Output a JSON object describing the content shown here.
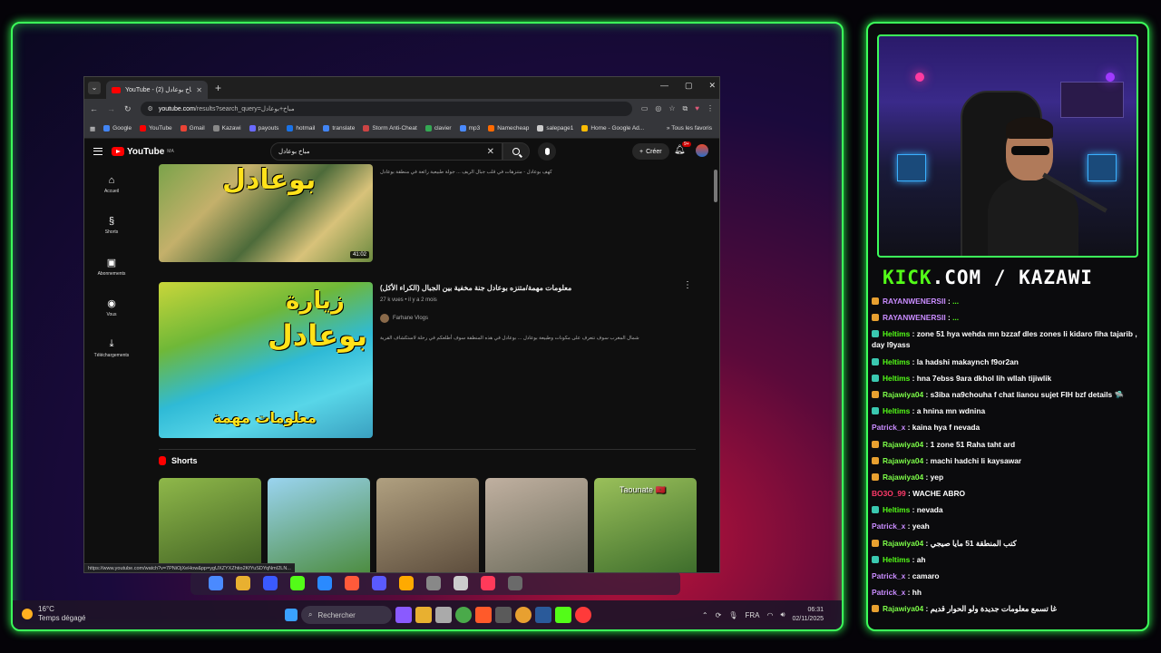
{
  "browser": {
    "tab_title": "YouTube - مباخ بوعادل (2)",
    "url_host": "youtube.com",
    "url_path": "/results?search_query=مباخ+بوعادل",
    "bookmarks": [
      {
        "label": "Google",
        "color": "#4285f4"
      },
      {
        "label": "YouTube",
        "color": "#ff0000"
      },
      {
        "label": "Gmail",
        "color": "#ea4335"
      },
      {
        "label": "Kazawi",
        "color": "#888888"
      },
      {
        "label": "payouts",
        "color": "#6a6aff"
      },
      {
        "label": "hotmail",
        "color": "#1a73e8"
      },
      {
        "label": "translate",
        "color": "#4285f4"
      },
      {
        "label": "Storm Anti-Cheat",
        "color": "#cc4444"
      },
      {
        "label": "clavier",
        "color": "#34a853"
      },
      {
        "label": "mp3",
        "color": "#4a8aff"
      },
      {
        "label": "Namecheap",
        "color": "#ff6a00"
      },
      {
        "label": "salepage1",
        "color": "#cccccc"
      },
      {
        "label": "Home - Google Ad...",
        "color": "#fbbc04"
      }
    ],
    "all_bookmarks": "Tous les favoris",
    "status_url": "https://www.youtube.com/watch?v=7PNiOjXeHow&pp=ygUXZYXZhtio2KfYuSDYqNmI2LN..."
  },
  "youtube": {
    "logo": "YouTube",
    "logo_region": "MA",
    "search_value": "مباخ بوعادل",
    "create_label": "Créer",
    "notif_count": "9+",
    "sidebar": [
      {
        "icon": "home-icon",
        "glyph": "⌂",
        "label": "Accueil"
      },
      {
        "icon": "shorts-icon",
        "glyph": "§",
        "label": "Shorts"
      },
      {
        "icon": "subscriptions-icon",
        "glyph": "▣",
        "label": "Abonnements"
      },
      {
        "icon": "you-icon",
        "glyph": "◉",
        "label": "Vous"
      },
      {
        "icon": "download-icon",
        "glyph": "⤓",
        "label": "Téléchargements"
      }
    ],
    "video1": {
      "thumb_text": "بوعادل",
      "duration": "41:02",
      "desc": "كهف بوعادل - متنزهات في قلب جبال الريف ... جولة طبيعية رائعة في منطقة بوعادل"
    },
    "video2": {
      "title": "معلومات مهمة/متنزه بوعادل جنة مخفية بين الجبال (الكراء الأكل)",
      "thumb_top": "زيارة",
      "thumb_mid": "بوعادل",
      "thumb_bottom": "معلومات مهمة",
      "views": "27 k vues",
      "age": "il y a 2 mois",
      "channel": "Farhane Vlogs",
      "desc": "شمال المغرب سوف نتعرف على مكونات وطبيعة بوعادل ... بوعادل في هذه المنطقة سوف أطلعكم في رحلة لاستكشاف القرية"
    },
    "shorts_heading": "Shorts",
    "shorts": [
      {
        "caption": "",
        "color1": "#8fb84a",
        "color2": "#3a5a20"
      },
      {
        "caption": "",
        "color1": "#9ad4f0",
        "color2": "#4a8a3a"
      },
      {
        "caption": "",
        "color1": "#b0a080",
        "color2": "#5a4a3a"
      },
      {
        "caption": "",
        "color1": "#c0b0a0",
        "color2": "#6a6a5a"
      },
      {
        "caption": "Taounate 🇲🇦",
        "color1": "#9ac05a",
        "color2": "#3a6a2a"
      }
    ]
  },
  "taskbar": {
    "temperature": "16°C",
    "weather": "Temps dégagé",
    "search_placeholder": "Rechercher",
    "lang": "FRA",
    "time": "06:31",
    "date": "02/11/2025"
  },
  "stream": {
    "kick_brand": "KICK",
    "kick_rest": ".COM / KAZAWI"
  },
  "chat": [
    {
      "user": "RAYANWENERSII",
      "color": "#c98cff",
      "text": "...",
      "badge": "#e8a030"
    },
    {
      "user": "RAYANWENERSII",
      "color": "#c98cff",
      "text": "...",
      "badge": "#e8a030"
    },
    {
      "user": "Heltims",
      "color": "#53fc18",
      "text": "zone 51 hya wehda mn bzzaf dles zones li kidaro fiha tajarib , day l9yass",
      "badge": "#3ac8b0"
    },
    {
      "user": "Heltims",
      "color": "#53fc18",
      "text": "la hadshi makaynch f9or2an",
      "badge": "#3ac8b0"
    },
    {
      "user": "Heltims",
      "color": "#53fc18",
      "text": "hna 7ebss 9ara dkhol lih wllah tijiwlik",
      "badge": "#3ac8b0"
    },
    {
      "user": "Rajawiya04",
      "color": "#7cfc48",
      "text": "s3iba na9chouha f chat lianou sujet FIH bzf details 🛸",
      "badge": "#e8a030"
    },
    {
      "user": "Heltims",
      "color": "#53fc18",
      "text": "a hnina mn wdnina",
      "badge": "#3ac8b0"
    },
    {
      "user": "Patrick_x",
      "color": "#c98cff",
      "text": "kaina hya f nevada",
      "badge": ""
    },
    {
      "user": "Rajawiya04",
      "color": "#7cfc48",
      "text": "1 zone 51 Raha taht ard",
      "badge": "#e8a030"
    },
    {
      "user": "Rajawiya04",
      "color": "#7cfc48",
      "text": "machi hadchi li kaysawar",
      "badge": "#e8a030"
    },
    {
      "user": "Rajawiya04",
      "color": "#7cfc48",
      "text": "yep",
      "badge": "#e8a030"
    },
    {
      "user": "BO3O_99",
      "color": "#ff3a6a",
      "text": "WACHE ABRO",
      "badge": ""
    },
    {
      "user": "Heltims",
      "color": "#53fc18",
      "text": "nevada",
      "badge": "#3ac8b0"
    },
    {
      "user": "Patrick_x",
      "color": "#c98cff",
      "text": "yeah",
      "badge": ""
    },
    {
      "user": "Rajawiya04",
      "color": "#7cfc48",
      "text": "كتب المنطقة 51 مايا صيجي",
      "badge": "#e8a030"
    },
    {
      "user": "Heltims",
      "color": "#53fc18",
      "text": "ah",
      "badge": "#3ac8b0"
    },
    {
      "user": "Patrick_x",
      "color": "#c98cff",
      "text": "camaro",
      "badge": ""
    },
    {
      "user": "Patrick_x",
      "color": "#c98cff",
      "text": "hh",
      "badge": ""
    },
    {
      "user": "Rajawiya04",
      "color": "#7cfc48",
      "text": "غا تسمع معلومات جديدة ولو الحوار قديم",
      "badge": "#e8a030"
    }
  ]
}
